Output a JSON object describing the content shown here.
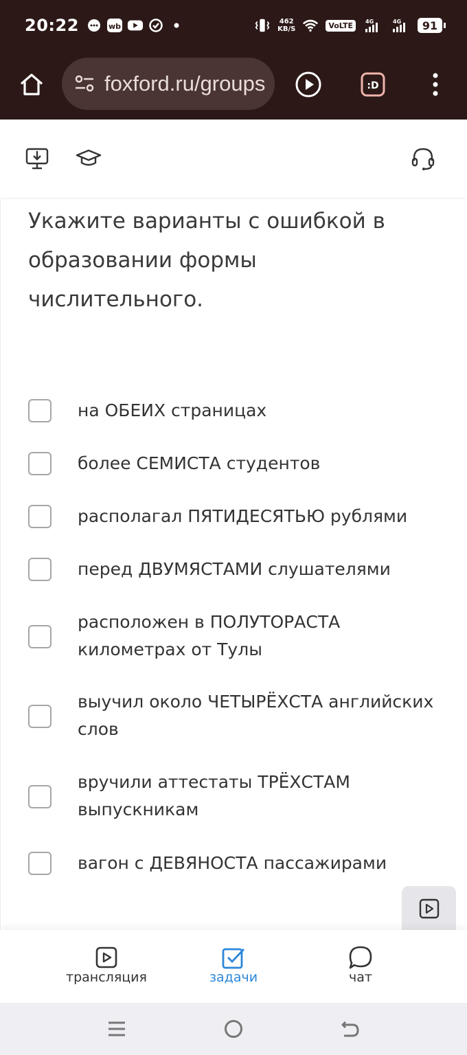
{
  "status_bar": {
    "time": "20:22",
    "net_speed_value": "462",
    "net_speed_unit": "KB/S",
    "volte": "VoLTE",
    "sim1_signal": "4G",
    "sim2_signal": "4G",
    "battery": "91"
  },
  "browser": {
    "url": "foxford.ru/groups"
  },
  "question": {
    "text": "Укажите варианты с ошибкой в образовании формы числительного."
  },
  "options": [
    {
      "label": "на ОБЕИХ страницах",
      "checked": false
    },
    {
      "label": "более СЕМИСТА студентов",
      "checked": false
    },
    {
      "label": "располагал ПЯТИДЕСЯТЬЮ рублями",
      "checked": false
    },
    {
      "label": "перед ДВУМЯСТАМИ слушателями",
      "checked": false
    },
    {
      "label": "расположен в ПОЛУТОРАСТА километрах от Тулы",
      "checked": false
    },
    {
      "label": "выучил около ЧЕТЫРЁХСТА английских слов",
      "checked": false
    },
    {
      "label": "вручили аттестаты ТРЁХСТАМ выпускникам",
      "checked": false
    },
    {
      "label": "вагон с ДЕВЯНОСТА пассажирами",
      "checked": false
    }
  ],
  "bottom_nav": {
    "items": [
      {
        "label": "трансляция",
        "icon": "play-square-icon",
        "active": false
      },
      {
        "label": "задачи",
        "icon": "checkbox-icon",
        "active": true
      },
      {
        "label": "чат",
        "icon": "chat-bubble-icon",
        "active": false
      }
    ]
  },
  "colors": {
    "browser_bg": "#2c1917",
    "url_pill": "#4a3532",
    "active_tab": "#2b86d9"
  }
}
